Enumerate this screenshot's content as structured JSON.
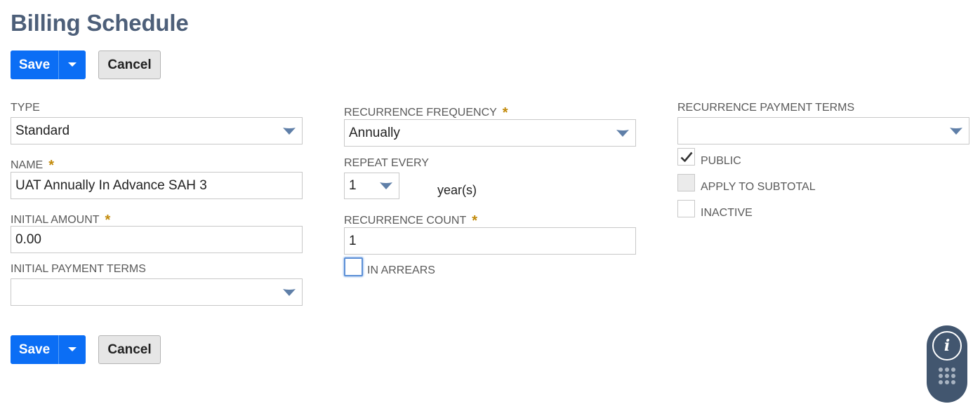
{
  "page": {
    "title": "Billing Schedule"
  },
  "toolbar": {
    "save_label": "Save",
    "cancel_label": "Cancel"
  },
  "form": {
    "type": {
      "label": "TYPE",
      "value": "Standard"
    },
    "name": {
      "label": "NAME",
      "value": "UAT Annually In Advance SAH 3",
      "required_mark": "*"
    },
    "initial_amount": {
      "label": "INITIAL AMOUNT",
      "value": "0.00",
      "required_mark": "*"
    },
    "initial_payment_terms": {
      "label": "INITIAL PAYMENT TERMS",
      "value": ""
    },
    "recurrence_frequency": {
      "label": "RECURRENCE FREQUENCY",
      "value": "Annually",
      "required_mark": "*"
    },
    "repeat_every": {
      "label": "REPEAT EVERY",
      "value": "1",
      "unit": "year(s)"
    },
    "recurrence_count": {
      "label": "RECURRENCE COUNT",
      "value": "1",
      "required_mark": "*"
    },
    "in_arrears": {
      "label": "IN ARREARS",
      "checked": false
    },
    "recurrence_payment_terms": {
      "label": "RECURRENCE PAYMENT TERMS",
      "value": ""
    },
    "public": {
      "label": "PUBLIC",
      "checked": true
    },
    "apply_to_subtotal": {
      "label": "APPLY TO SUBTOTAL",
      "checked": false,
      "disabled": true
    },
    "inactive": {
      "label": "INACTIVE",
      "checked": false
    }
  },
  "help": {
    "info_icon": "info-icon",
    "apps_icon": "grid-dots-icon"
  },
  "colors": {
    "primary_button": "#0b6ef5",
    "title": "#4d5f79",
    "required": "#c28a0a",
    "help_widget": "#42566f"
  }
}
